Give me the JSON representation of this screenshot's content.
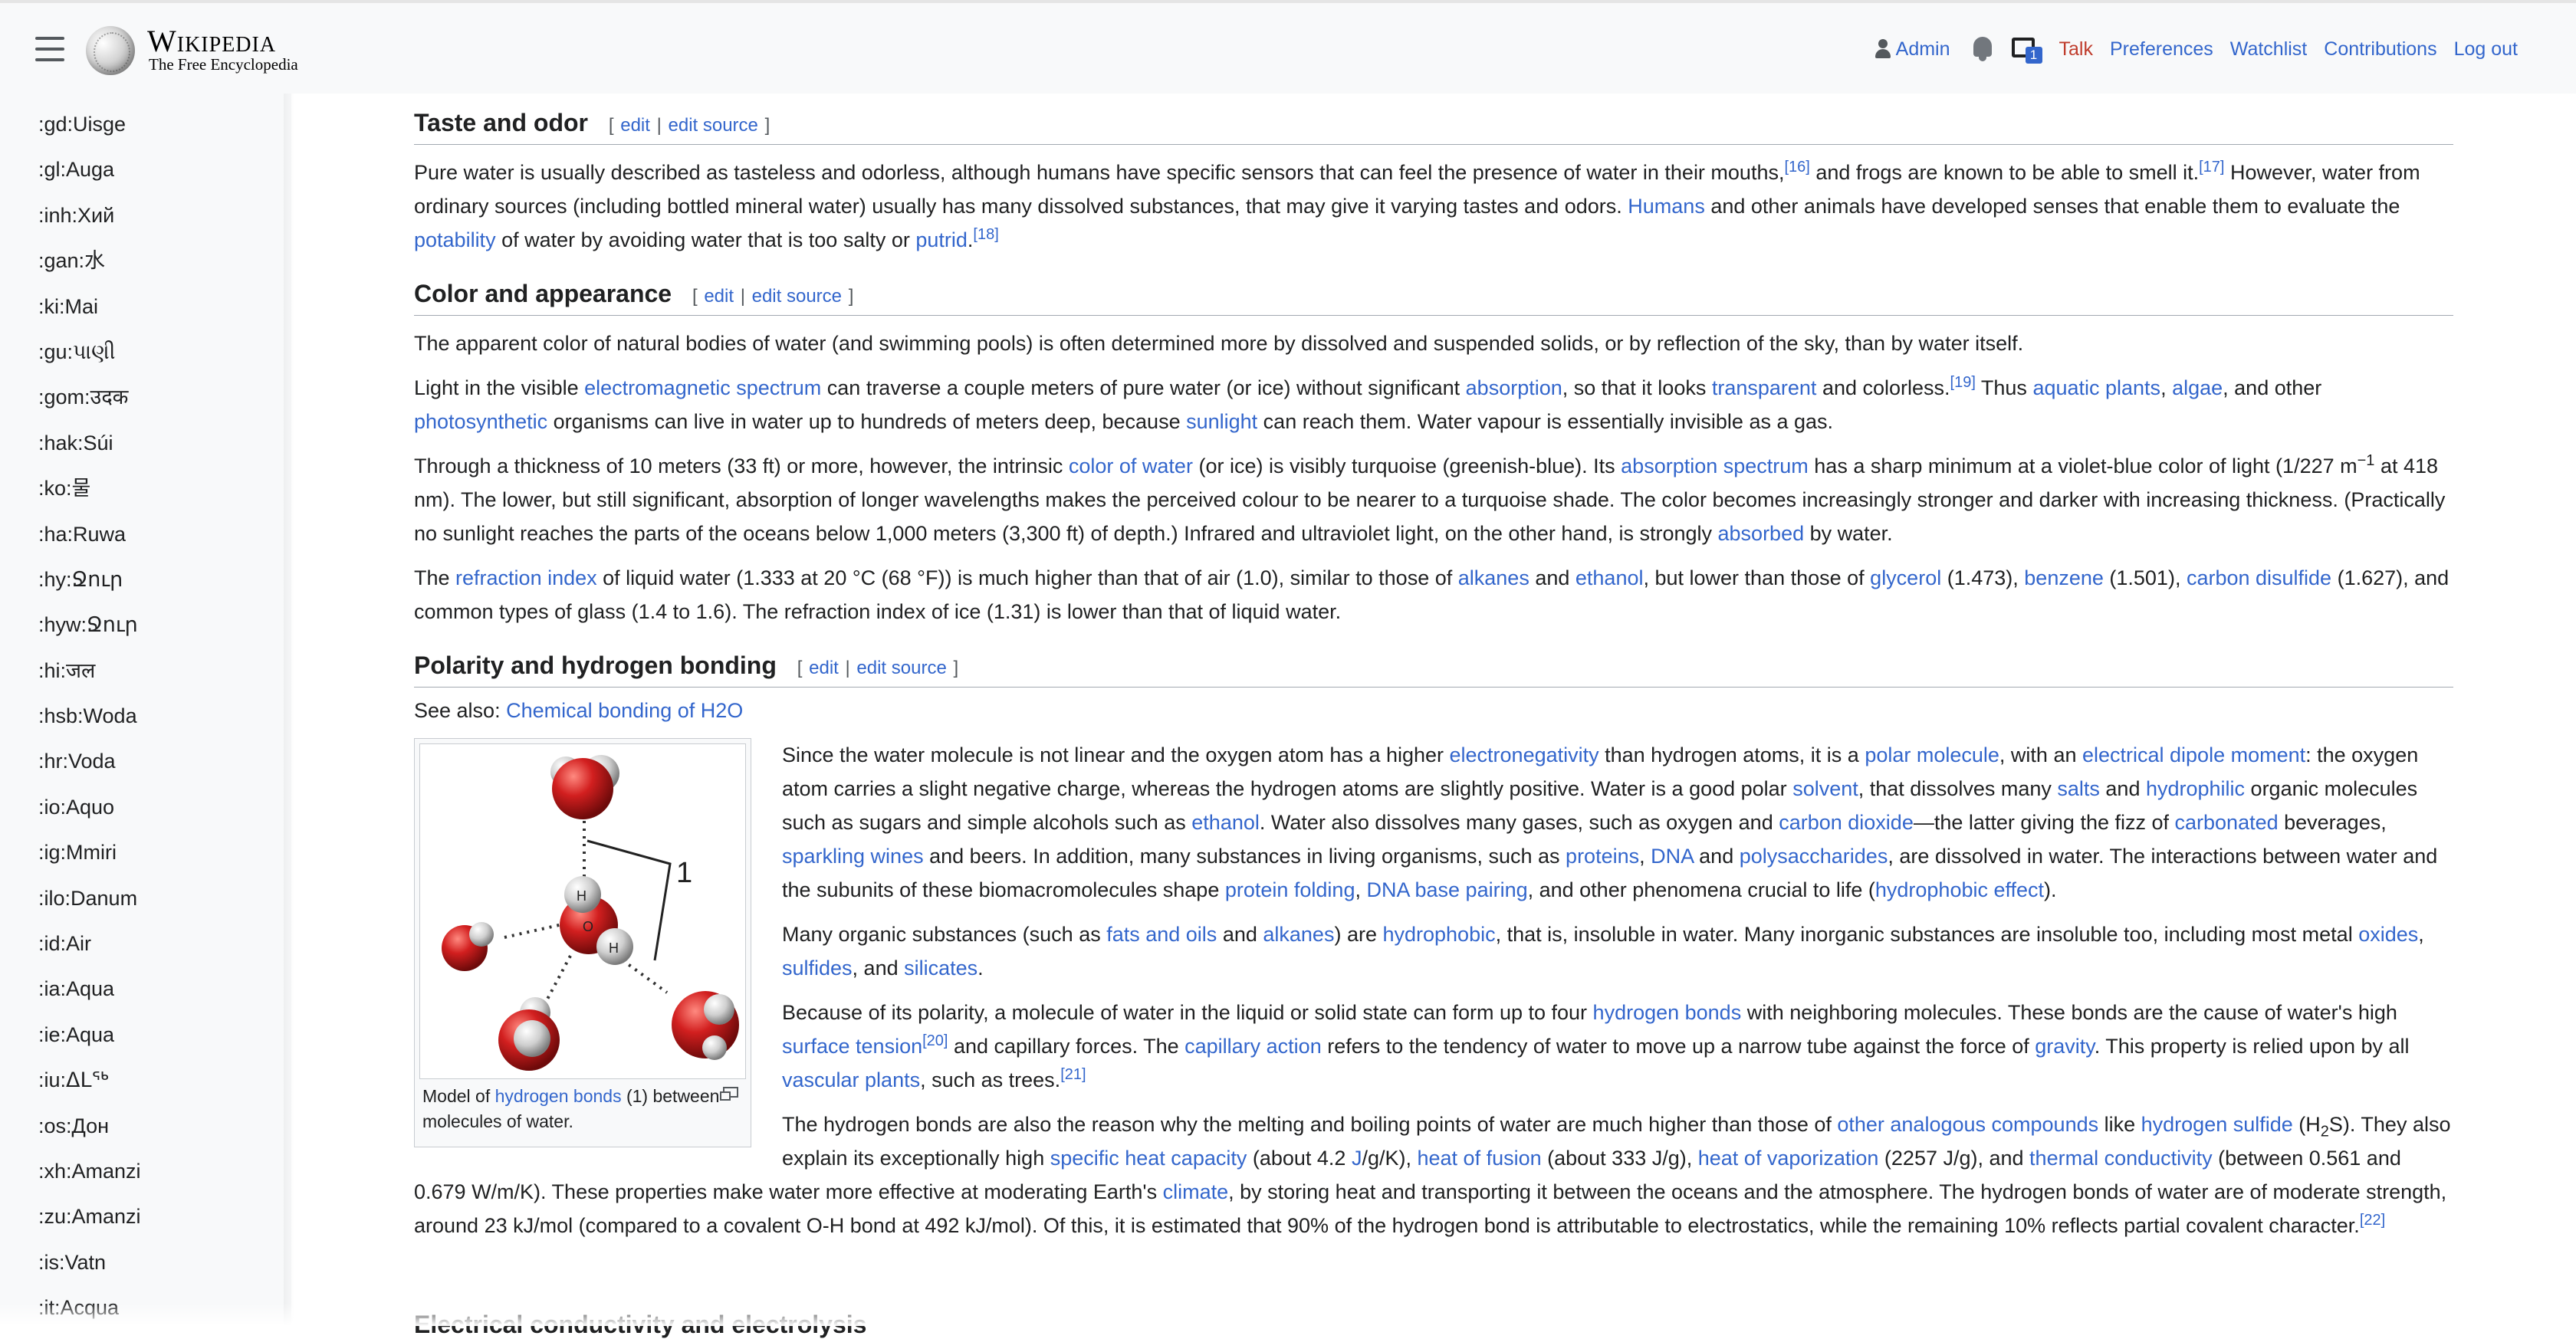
{
  "header": {
    "wordmark": "Wikipedia",
    "tagline": "The Free Encyclopedia",
    "user": "Admin",
    "notification_count": "1",
    "links": [
      "Talk",
      "Preferences",
      "Watchlist",
      "Contributions",
      "Log out"
    ]
  },
  "sidebar": {
    "items": [
      ":gd:Uisge",
      ":gl:Auga",
      ":inh:Хий",
      ":gan:水",
      ":ki:Mai",
      ":gu:પાણી",
      ":gom:उदक",
      ":hak:Súi",
      ":ko:물",
      ":ha:Ruwa",
      ":hy:Ջուր",
      ":hyw:Ջուր",
      ":hi:जल",
      ":hsb:Woda",
      ":hr:Voda",
      ":io:Aquo",
      ":ig:Mmiri",
      ":ilo:Danum",
      ":id:Air",
      ":ia:Aqua",
      ":ie:Aqua",
      ":iu:ᐃᒪᖅ",
      ":os:Дон",
      ":xh:Amanzi",
      ":zu:Amanzi",
      ":is:Vatn",
      ":it:Acqua"
    ]
  },
  "editsection": {
    "edit": "edit",
    "edit_source": "edit source",
    "open": "[",
    "sep": "|",
    "close": "]"
  },
  "sections": {
    "taste": {
      "title": "Taste and odor",
      "p1": {
        "t1": "Pure water is usually described as tasteless and odorless, although humans have specific sensors that can feel the presence of water in their mouths,",
        "r1": "[16]",
        "t2": " and frogs are known to be able to smell it.",
        "r2": "[17]",
        "t3": " However, water from ordinary sources (including bottled mineral water) usually has many dissolved substances, that may give it varying tastes and odors. ",
        "l1": "Humans",
        "t4": " and other animals have developed senses that enable them to evaluate the ",
        "l2": "potability",
        "t5": " of water by avoiding water that is too salty or ",
        "l3": "putrid",
        "t6": ".",
        "r3": "[18]"
      }
    },
    "color": {
      "title": "Color and appearance",
      "p1": "The apparent color of natural bodies of water (and swimming pools) is often determined more by dissolved and suspended solids, or by reflection of the sky, than by water itself.",
      "p2": {
        "t1": "Light in the visible ",
        "l1": "electromagnetic spectrum",
        "t2": " can traverse a couple meters of pure water (or ice) without significant ",
        "l2": "absorption",
        "t3": ", so that it looks ",
        "l3": "transparent",
        "t4": " and colorless.",
        "r1": "[19]",
        "t5": " Thus ",
        "l4": "aquatic plants",
        "t6": ", ",
        "l5": "algae",
        "t7": ", and other ",
        "l6": "photosynthetic",
        "t8": " organisms can live in water up to hundreds of meters deep, because ",
        "l7": "sunlight",
        "t9": " can reach them. Water vapour is essentially invisible as a gas."
      },
      "p3": {
        "t1": "Through a thickness of 10 meters (33 ft) or more, however, the intrinsic ",
        "l1": "color of water",
        "t2": " (or ice) is visibly turquoise (greenish-blue). Its ",
        "l2": "absorption spectrum",
        "t3": " has a sharp minimum at a violet-blue color of light (1/227 m",
        "s1": "−1",
        "t4": " at 418 nm). The lower, but still significant, absorption of longer wavelengths makes the perceived colour to be nearer to a turquoise shade. The color becomes increasingly stronger and darker with increasing thickness. (Practically no sunlight reaches the parts of the oceans below 1,000 meters (3,300 ft) of depth.) Infrared and ultraviolet light, on the other hand, is strongly ",
        "l3": "absorbed",
        "t5": " by water."
      },
      "p4": {
        "t1": "The ",
        "l1": "refraction index",
        "t2": " of liquid water (1.333 at 20 °C (68 °F)) is much higher than that of air (1.0), similar to those of ",
        "l2": "alkanes",
        "t3": " and ",
        "l3": "ethanol",
        "t4": ", but lower than those of ",
        "l4": "glycerol",
        "t5": " (1.473), ",
        "l5": "benzene",
        "t6": " (1.501), ",
        "l6": "carbon disulfide",
        "t7": " (1.627), and common types of glass (1.4 to 1.6). The refraction index of ice (1.31) is lower than that of liquid water."
      }
    },
    "polarity": {
      "title": "Polarity and hydrogen bonding",
      "see_also_label": "See also: ",
      "see_also_link": "Chemical bonding of H2O",
      "figure": {
        "label_1": "1",
        "atom_h": "H",
        "atom_o": "O",
        "caption_t1": "Model of ",
        "caption_link": "hydrogen bonds",
        "caption_t2": " (1) between molecules of water."
      },
      "p1": {
        "t1": "Since the water molecule is not linear and the oxygen atom has a higher ",
        "l1": "electronegativity",
        "t2": " than hydrogen atoms, it is a ",
        "l2": "polar molecule",
        "t3": ", with an ",
        "l3": "electrical dipole moment",
        "t4": ": the oxygen atom carries a slight negative charge, whereas the hydrogen atoms are slightly positive. Water is a good polar ",
        "l4": "solvent",
        "t5": ", that dissolves many ",
        "l5": "salts",
        "t6": " and ",
        "l6": "hydrophilic",
        "t7": " organic molecules such as sugars and simple alcohols such as ",
        "l7": "ethanol",
        "t8": ". Water also dissolves many gases, such as oxygen and ",
        "l8": "carbon dioxide",
        "t9": "—the latter giving the fizz of ",
        "l9": "carbonated",
        "t10": " beverages, ",
        "l10": "sparkling wines",
        "t11": " and beers. In addition, many substances in living organisms, such as ",
        "l11": "proteins",
        "t12": ", ",
        "l12": "DNA",
        "t13": " and ",
        "l13": "polysaccharides",
        "t14": ", are dissolved in water. The interactions between water and the subunits of these biomacromolecules shape ",
        "l14": "protein folding",
        "t15": ", ",
        "l15": "DNA base pairing",
        "t16": ", and other phenomena crucial to life (",
        "l16": "hydrophobic effect",
        "t17": ")."
      },
      "p2": {
        "t1": "Many organic substances (such as ",
        "l1": "fats and oils",
        "t2": " and ",
        "l2": "alkanes",
        "t3": ") are ",
        "l3": "hydrophobic",
        "t4": ", that is, insoluble in water. Many inorganic substances are insoluble too, including most metal ",
        "l4": "oxides",
        "t5": ", ",
        "l5": "sulfides",
        "t6": ", and ",
        "l6": "silicates",
        "t7": "."
      },
      "p3": {
        "t1": "Because of its polarity, a molecule of water in the liquid or solid state can form up to four ",
        "l1": "hydrogen bonds",
        "t2": " with neighboring molecules. These bonds are the cause of water's high ",
        "l2": "surface tension",
        "r1": "[20]",
        "t3": " and capillary forces. The ",
        "l3": "capillary action",
        "t4": " refers to the tendency of water to move up a narrow tube against the force of ",
        "l4": "gravity",
        "t5": ". This property is relied upon by all ",
        "l5": "vascular plants",
        "t6": ", such as trees.",
        "r2": "[21]"
      },
      "p4": {
        "t1": "The hydrogen bonds are also the reason why the melting and boiling points of water are much higher than those of ",
        "l1": "other analogous compounds",
        "t2": " like ",
        "l2": "hydrogen sulfide",
        "t3": " (H",
        "s1": "2",
        "t4": "S). They also explain its exceptionally high ",
        "l3": "specific heat capacity",
        "t5": " (about 4.2 ",
        "l4": "J",
        "t6": "/g/K), ",
        "l5": "heat of fusion",
        "t7": " (about 333 J/g), ",
        "l6": "heat of vaporization",
        "t8": " (2257 J/g), and ",
        "l7": "thermal conductivity",
        "t9": " (between 0.561 and 0.679 W/m/K). These properties make water more effective at moderating Earth's ",
        "l8": "climate",
        "t10": ", by storing heat and transporting it between the oceans and the atmosphere. The hydrogen bonds of water are of moderate strength, around 23 kJ/mol (compared to a covalent O-H bond at 492 kJ/mol). Of this, it is estimated that 90% of the hydrogen bond is attributable to electrostatics, while the remaining 10% reflects partial covalent character.",
        "r1": "[22]"
      }
    },
    "next_heading": "Electrical conductivity and electrolysis"
  }
}
